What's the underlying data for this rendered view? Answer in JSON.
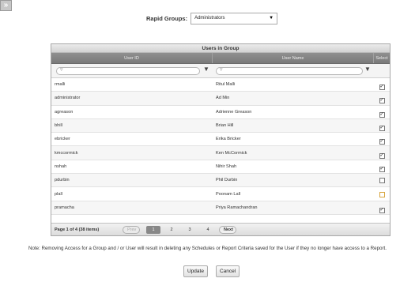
{
  "toggle_icon": "double-chevron-right-icon",
  "rapid_groups": {
    "label": "Rapid Groups:",
    "selected": "Administrators"
  },
  "grid": {
    "title": "Users in Group",
    "columns": {
      "user_id": "User ID",
      "user_name": "User Name",
      "select": "Select"
    },
    "rows": [
      {
        "id": "rmalli",
        "name": "Ritul Malli",
        "selected": true
      },
      {
        "id": "administrator",
        "name": "Ad Min",
        "selected": true
      },
      {
        "id": "agreason",
        "name": "Adrienne Greason",
        "selected": true
      },
      {
        "id": "bhill",
        "name": "Brian Hill",
        "selected": true
      },
      {
        "id": "ebricker",
        "name": "Erika Bricker",
        "selected": true
      },
      {
        "id": "kmccormick",
        "name": "Ken McCormick",
        "selected": true
      },
      {
        "id": "nshah",
        "name": "Nihir Shah",
        "selected": true
      },
      {
        "id": "pdurbin",
        "name": "Phil Durbin",
        "selected": false
      },
      {
        "id": "plall",
        "name": "Poonam Lall",
        "selected": false,
        "highlight": true
      },
      {
        "id": "pramacha",
        "name": "Priya Ramachandran",
        "selected": true
      }
    ],
    "pager": {
      "info": "Page 1 of 4 (38 items)",
      "prev": "Prev",
      "next": "Next",
      "pages": [
        "1",
        "2",
        "3",
        "4"
      ],
      "current": "1"
    }
  },
  "note": "Note: Removing Access for a Group and / or User will result in deleting any Schedules or Report Criteria saved for the User if they no longer have access to a Report.",
  "buttons": {
    "update": "Update",
    "cancel": "Cancel"
  }
}
